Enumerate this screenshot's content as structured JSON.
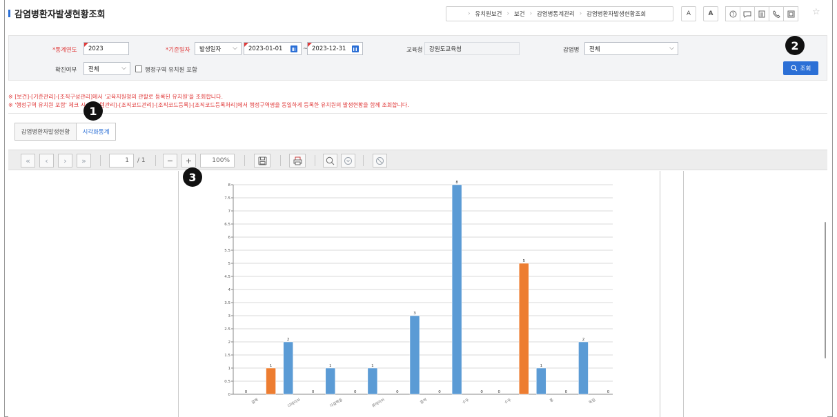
{
  "header": {
    "title": "감염병환자발생현황조회",
    "breadcrumb": [
      "유치원보건",
      "보건",
      "감염병통계관리",
      "감염병환자발생현황조회"
    ],
    "font_small": "A",
    "font_large": "A"
  },
  "search": {
    "year_label": "*통계연도",
    "year_value": "2023",
    "date_label": "*기준일자",
    "date_type": "발생일자",
    "date_from": "2023-01-01",
    "date_tilde": "~",
    "date_to": "2023-12-31",
    "office_label": "교육청",
    "office_value": "강원도교육청",
    "disease_label": "감염병",
    "disease_value": "전체",
    "confirm_label": "확진여부",
    "confirm_value": "전체",
    "admin_checkbox_label": "행정구역 유치원 포함",
    "search_button": "조회"
  },
  "notes": [
    "※ [보건]-[기준관리]-[조직구성관리]에서 '교육지원청의 관할로 등록된 유치원'을 조회합니다.",
    "※ '행정구역 유치원 포함' 체크 시 [시스템관리]-[조직코드관리]-[조직코드등록]-[조직코드등록처리]에서 행정구역명을 동일하게 등록한 유치원의 발생현황을 함께 조회합니다."
  ],
  "tabs": [
    {
      "label": "감염병환자발생현황",
      "active": false
    },
    {
      "label": "시각화통계",
      "active": true
    }
  ],
  "report_toolbar": {
    "page_current": "1",
    "page_total": "/ 1",
    "zoom": "100%"
  },
  "badges": [
    "1",
    "2",
    "3"
  ],
  "colors": {
    "accent": "#2b6fd6",
    "series_blue": "#5b9bd5",
    "series_orange": "#ed7d31",
    "required": "#e03a3a"
  },
  "chart_data": {
    "type": "bar",
    "categories": [
      "결핵",
      "",
      "",
      "",
      "홍역",
      "수두",
      "수두",
      "",
      ""
    ],
    "tick_label_note": "x tick labels are partly cut off; visible fragments shown",
    "tick_fragments": [
      "결핵",
      "디테리아",
      "각결핵종",
      "류테리아",
      "홍역",
      "수두",
      "수두",
      "홍",
      "독립"
    ],
    "series": [
      {
        "values": [
          0,
          2,
          1,
          1,
          3,
          8,
          0,
          1,
          2
        ],
        "color": "#5b9bd5"
      },
      {
        "values": [
          1,
          0,
          0,
          0,
          0,
          0,
          5,
          0,
          0
        ],
        "color": "#ed7d31"
      }
    ],
    "ylim": [
      0,
      8
    ],
    "yticks": [
      "0",
      "0.5",
      "1",
      "1.5",
      "2",
      "2.5",
      "3",
      "3.5",
      "4",
      "4.5",
      "5",
      "5.5",
      "6",
      "6.5",
      "7",
      "7.5",
      "8"
    ],
    "grid": true,
    "data_labels": true
  }
}
